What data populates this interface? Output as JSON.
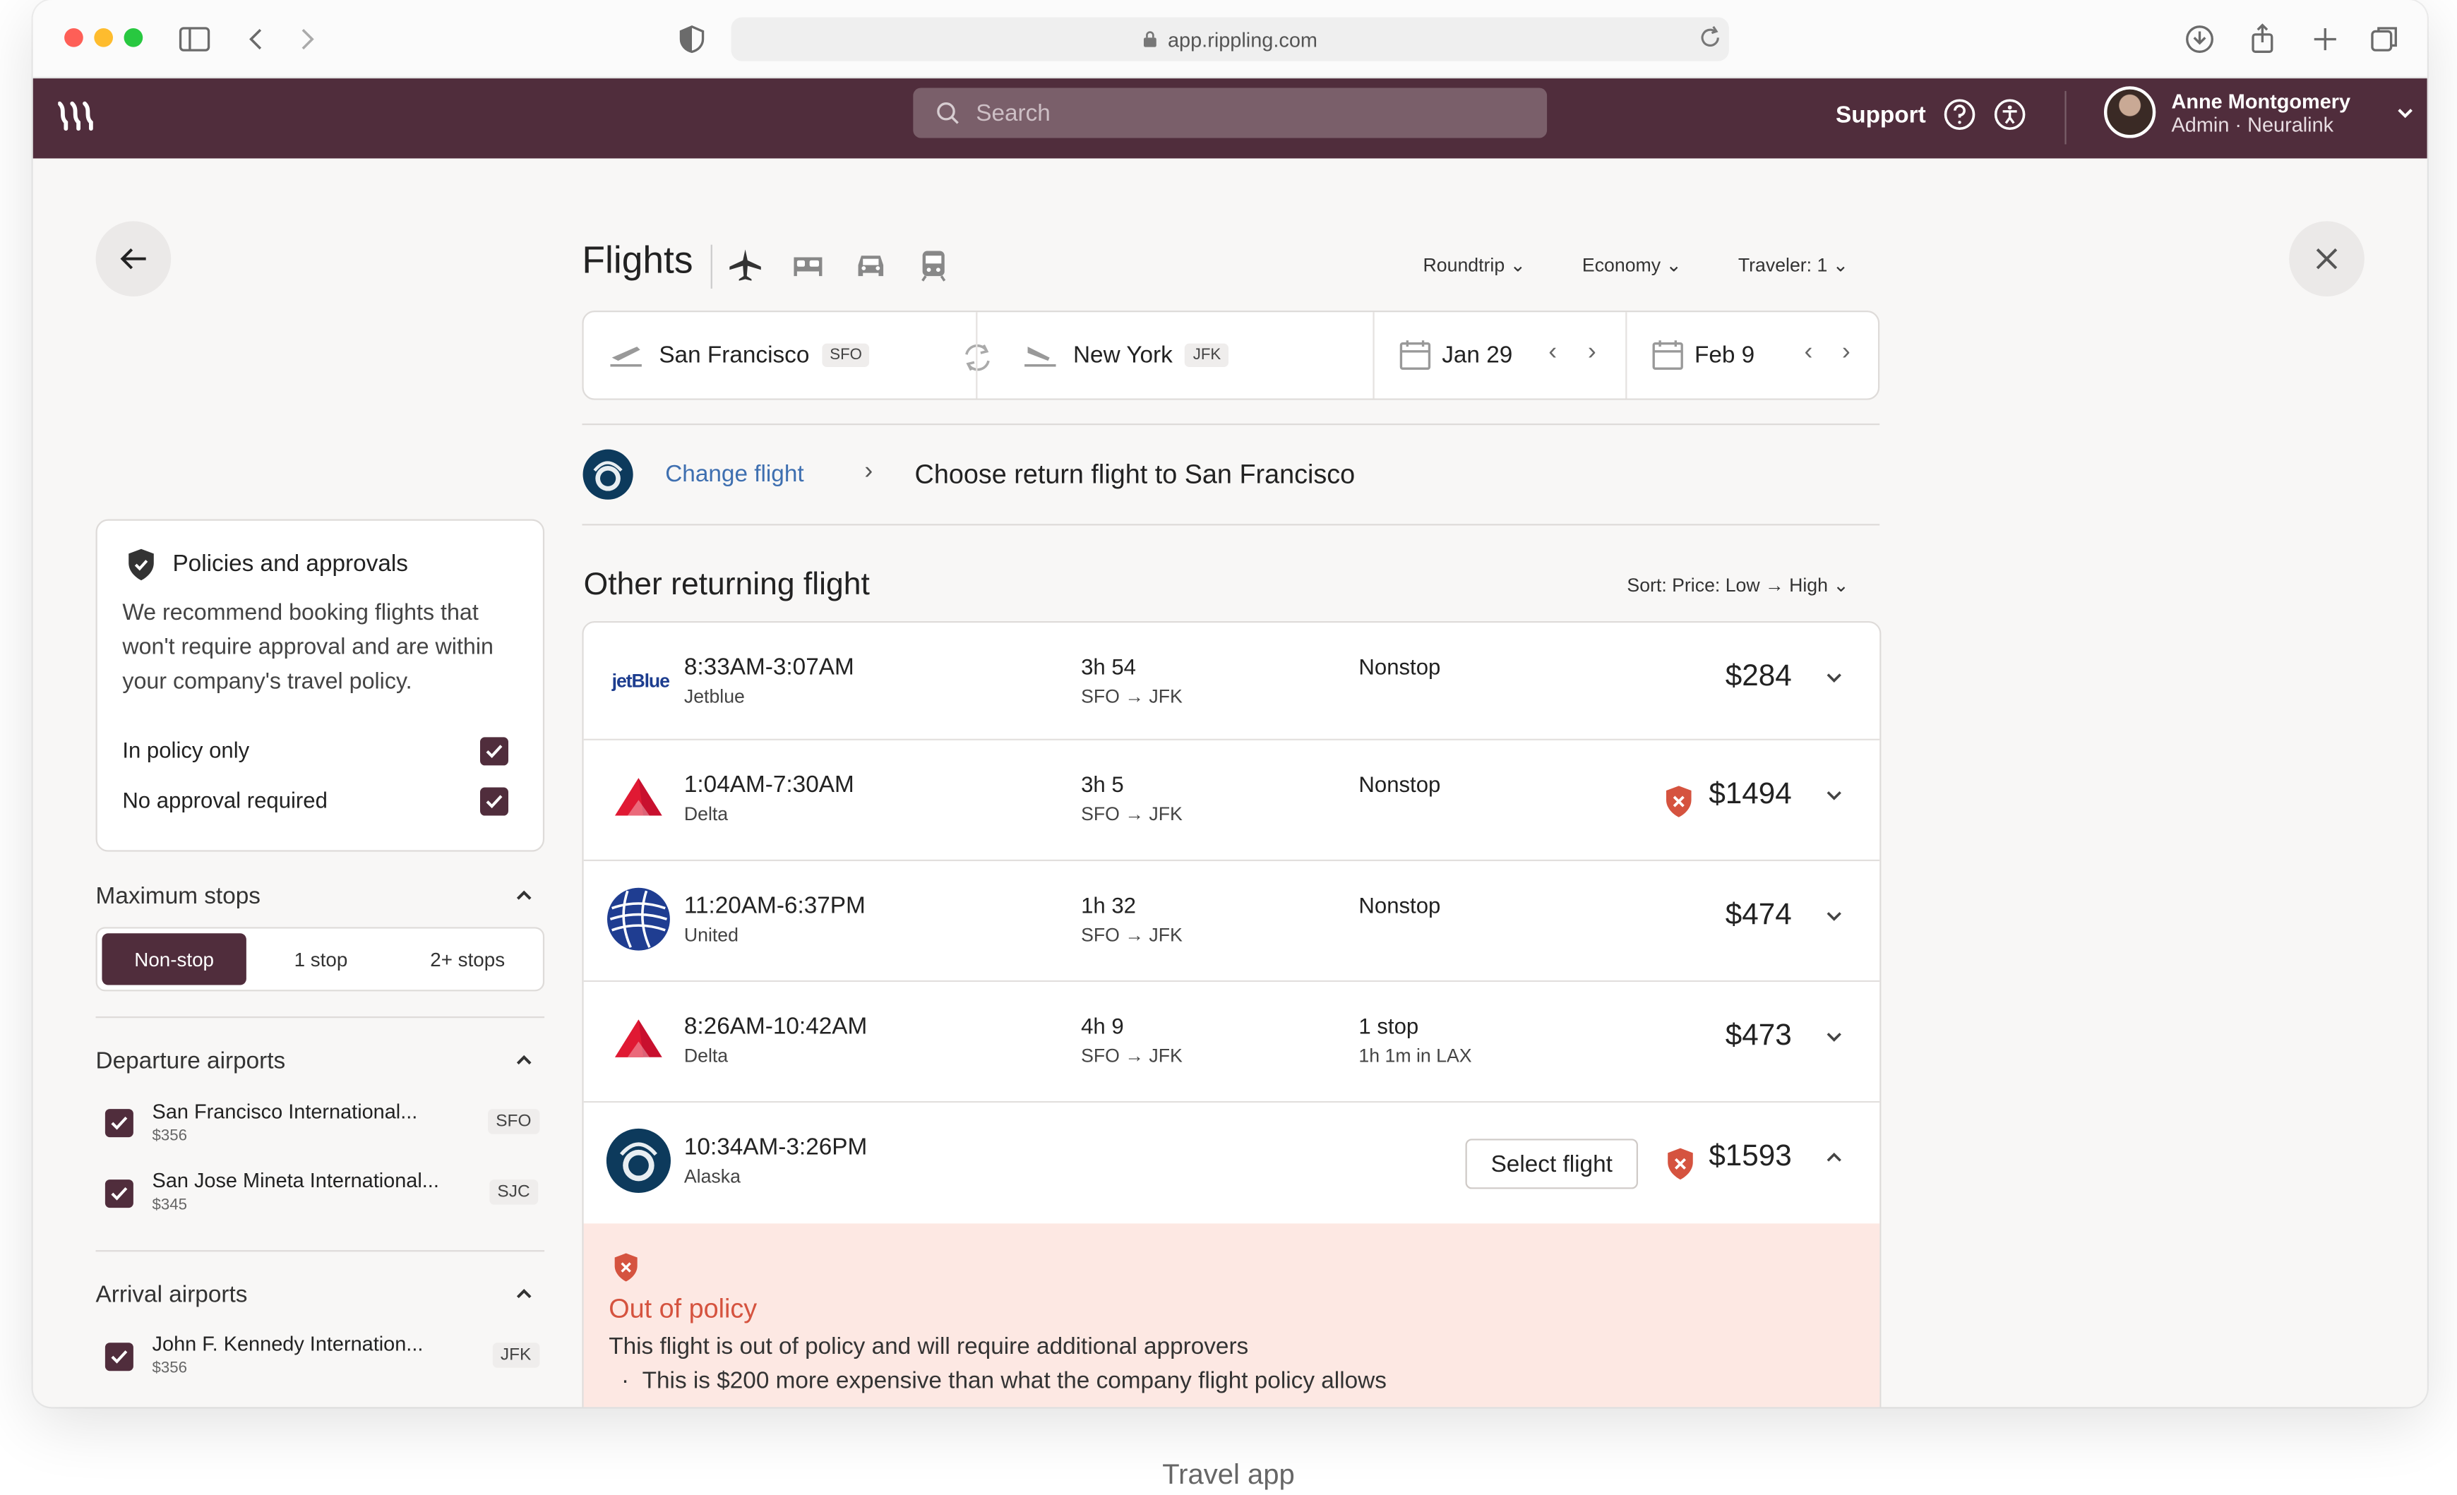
{
  "browser": {
    "url": "app.rippling.com"
  },
  "header": {
    "search_placeholder": "Search",
    "support_label": "Support",
    "user_name": "Anne Montgomery",
    "user_role": "Admin · Neuralink"
  },
  "travel": {
    "title": "Flights",
    "trip_type": "Roundtrip",
    "cabin": "Economy",
    "travelers": "Traveler: 1",
    "origin_city": "San Francisco",
    "origin_code": "SFO",
    "dest_city": "New York",
    "dest_code": "JFK",
    "depart_date": "Jan 29",
    "return_date": "Feb 9"
  },
  "breadcrumb": {
    "change_label": "Change flight",
    "current": "Choose return flight to San Francisco"
  },
  "results": {
    "heading": "Other returning flight",
    "sort_label": "Sort: Price: Low → High",
    "flights": [
      {
        "time": "8:33AM-3:07AM",
        "airline": "Jetblue",
        "logo_text": "jetBlue",
        "duration": "3h 54",
        "route": "SFO → JFK",
        "stops": "Nonstop",
        "stops_detail": "",
        "price": "$284"
      },
      {
        "time": "1:04AM-7:30AM",
        "airline": "Delta",
        "duration": "3h 5",
        "route": "SFO → JFK",
        "stops": "Nonstop",
        "stops_detail": "",
        "price": "$1494"
      },
      {
        "time": "11:20AM-6:37PM",
        "airline": "United",
        "duration": "1h 32",
        "route": "SFO → JFK",
        "stops": "Nonstop",
        "stops_detail": "",
        "price": "$474"
      },
      {
        "time": "8:26AM-10:42AM",
        "airline": "Delta",
        "duration": "4h 9",
        "route": "SFO → JFK",
        "stops": "1 stop",
        "stops_detail": "1h 1m in LAX",
        "price": "$473"
      },
      {
        "time": "10:34AM-3:26PM",
        "airline": "Alaska",
        "duration": "",
        "route": "",
        "stops": "",
        "stops_detail": "",
        "price": "$1593",
        "select_label": "Select flight"
      }
    ],
    "policy_title": "Out of policy",
    "policy_text": "This flight is out of policy and will require additional approvers",
    "policy_bullet": "This is $200 more expensive than what the company flight policy allows"
  },
  "sidebar": {
    "policy_title": "Policies and approvals",
    "policy_desc": "We recommend booking flights that won't require approval and are within your company's travel policy.",
    "in_policy_label": "In policy only",
    "no_approval_label": "No approval required",
    "max_stops_title": "Maximum stops",
    "stops_options": [
      "Non-stop",
      "1 stop",
      "2+ stops"
    ],
    "departure_title": "Departure airports",
    "departure_airports": [
      {
        "name": "San Francisco International...",
        "price": "$356",
        "code": "SFO"
      },
      {
        "name": "San Jose Mineta International...",
        "price": "$345",
        "code": "SJC"
      }
    ],
    "arrival_title": "Arrival airports",
    "arrival_airports": [
      {
        "name": "John F. Kennedy Internation...",
        "price": "$356",
        "code": "JFK"
      }
    ]
  },
  "caption": "Travel app",
  "colors": {
    "brand": "#502d3c",
    "policy_bg": "#fde8e3",
    "policy_red": "#d5533f",
    "link": "#3e6fb0"
  }
}
